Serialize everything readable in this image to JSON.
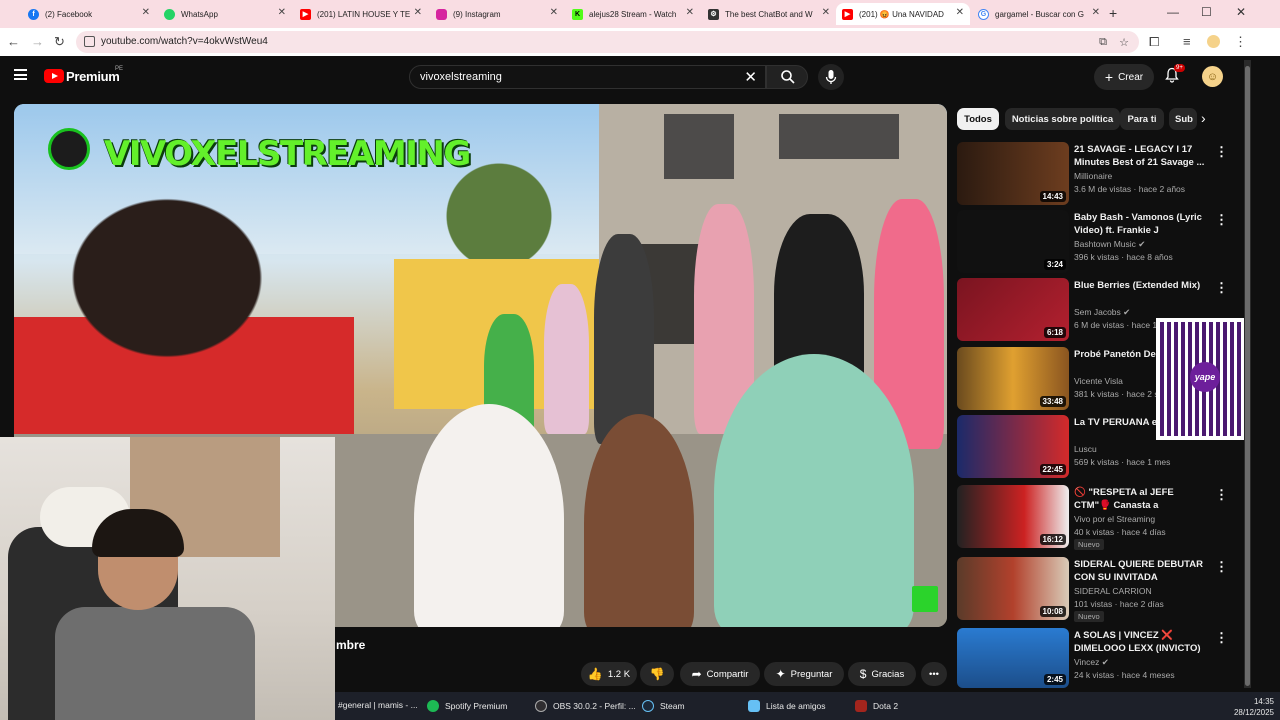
{
  "browser": {
    "tabs": [
      {
        "label": "(2) Facebook",
        "icon": "facebook-icon",
        "color": "#1877f2"
      },
      {
        "label": "WhatsApp",
        "icon": "whatsapp-icon",
        "color": "#25d366"
      },
      {
        "label": "(201) LATIN HOUSE Y TE",
        "icon": "youtube-icon",
        "color": "#ff0000"
      },
      {
        "label": "(9) Instagram",
        "icon": "instagram-icon",
        "color": "#d6249f"
      },
      {
        "label": "alejus28 Stream - Watch",
        "icon": "kick-icon",
        "color": "#53fc18"
      },
      {
        "label": "The best ChatBot and W",
        "icon": "chatbot-icon",
        "color": "#333333"
      },
      {
        "label": "(201) 😡 Una NAVIDAD",
        "icon": "youtube-icon",
        "color": "#ff0000"
      },
      {
        "label": "gargamel - Buscar con G",
        "icon": "google-icon",
        "color": "#4285f4"
      }
    ],
    "url": "youtube.com/watch?v=4okvWstWeu4"
  },
  "header": {
    "brand": "Premium",
    "region": "PE",
    "search_value": "vivoxelstreaming",
    "create_label": "Crear",
    "notif_badge": "9+"
  },
  "video": {
    "overlay_channel_text": "VIVOXELSTREAMING",
    "title_visible": "mbre",
    "actions": {
      "like_count": "1.2 K",
      "share": "Compartir",
      "ask": "Preguntar",
      "thanks": "Gracias"
    }
  },
  "chips": [
    "Todos",
    "Noticias sobre política",
    "Para ti",
    "Sub"
  ],
  "recommendations": [
    {
      "title": "21 SAVAGE - LEGACY I 17 Minutes Best of 21 Savage ...",
      "channel": "Millionaire",
      "meta": "3.6 M de vistas · hace 2 años",
      "duration": "14:43",
      "new": ""
    },
    {
      "title": "Baby Bash - Vamonos (Lyric Video) ft. Frankie J",
      "channel": "Bashtown Music ✔",
      "meta": "396 k vistas · hace 8 años",
      "duration": "3:24",
      "new": ""
    },
    {
      "title": "Blue Berries (Extended Mix)",
      "channel": "Sem Jacobs ✔",
      "meta": "6 M de vistas · hace 1 año",
      "duration": "6:18",
      "new": ""
    },
    {
      "title": "Probé Panetón De S/ S/437",
      "channel": "Vicente Visla",
      "meta": "381 k vistas · hace 2 s",
      "duration": "33:48",
      "new": ""
    },
    {
      "title": "La TV PERUANA es PEPA XD",
      "channel": "Luscu",
      "meta": "569 k vistas · hace 1 mes",
      "duration": "22:45",
      "new": ""
    },
    {
      "title": "🚫 \"RESPETA al JEFE CTM\"🥊 Canasta a CLIPEROS & ...",
      "channel": "Vivo por el Streaming",
      "meta": "40 k vistas · hace 4 días",
      "duration": "16:12",
      "new": "Nuevo"
    },
    {
      "title": "SIDERAL QUIERE DEBUTAR CON SU INVITADA ESPECIAL",
      "channel": "SIDERAL CARRION",
      "meta": "101 vistas · hace 2 días",
      "duration": "10:08",
      "new": "Nuevo"
    },
    {
      "title": "A SOLAS | VINCEZ ❌ DIMELOOO LEXX (INVICTO)",
      "channel": "Vincez ✔",
      "meta": "24 k vistas · hace 4 meses",
      "duration": "2:45",
      "new": ""
    }
  ],
  "qr": {
    "label": "yape"
  },
  "taskbar": {
    "items": [
      {
        "label": "#general | mamis - ...",
        "icon": "discord-icon",
        "color": "#5865f2"
      },
      {
        "label": "Spotify Premium",
        "icon": "spotify-icon",
        "color": "#1db954"
      },
      {
        "label": "OBS 30.0.2 - Perfil: ...",
        "icon": "obs-icon",
        "color": "#302e31"
      },
      {
        "label": "Steam",
        "icon": "steam-icon",
        "color": "#1b2838"
      },
      {
        "label": "Lista de amigos",
        "icon": "steam-friends-icon",
        "color": "#66c0f4"
      },
      {
        "label": "Dota 2",
        "icon": "dota-icon",
        "color": "#a3251d"
      }
    ],
    "time": "14:35",
    "date": "28/12/2025"
  }
}
